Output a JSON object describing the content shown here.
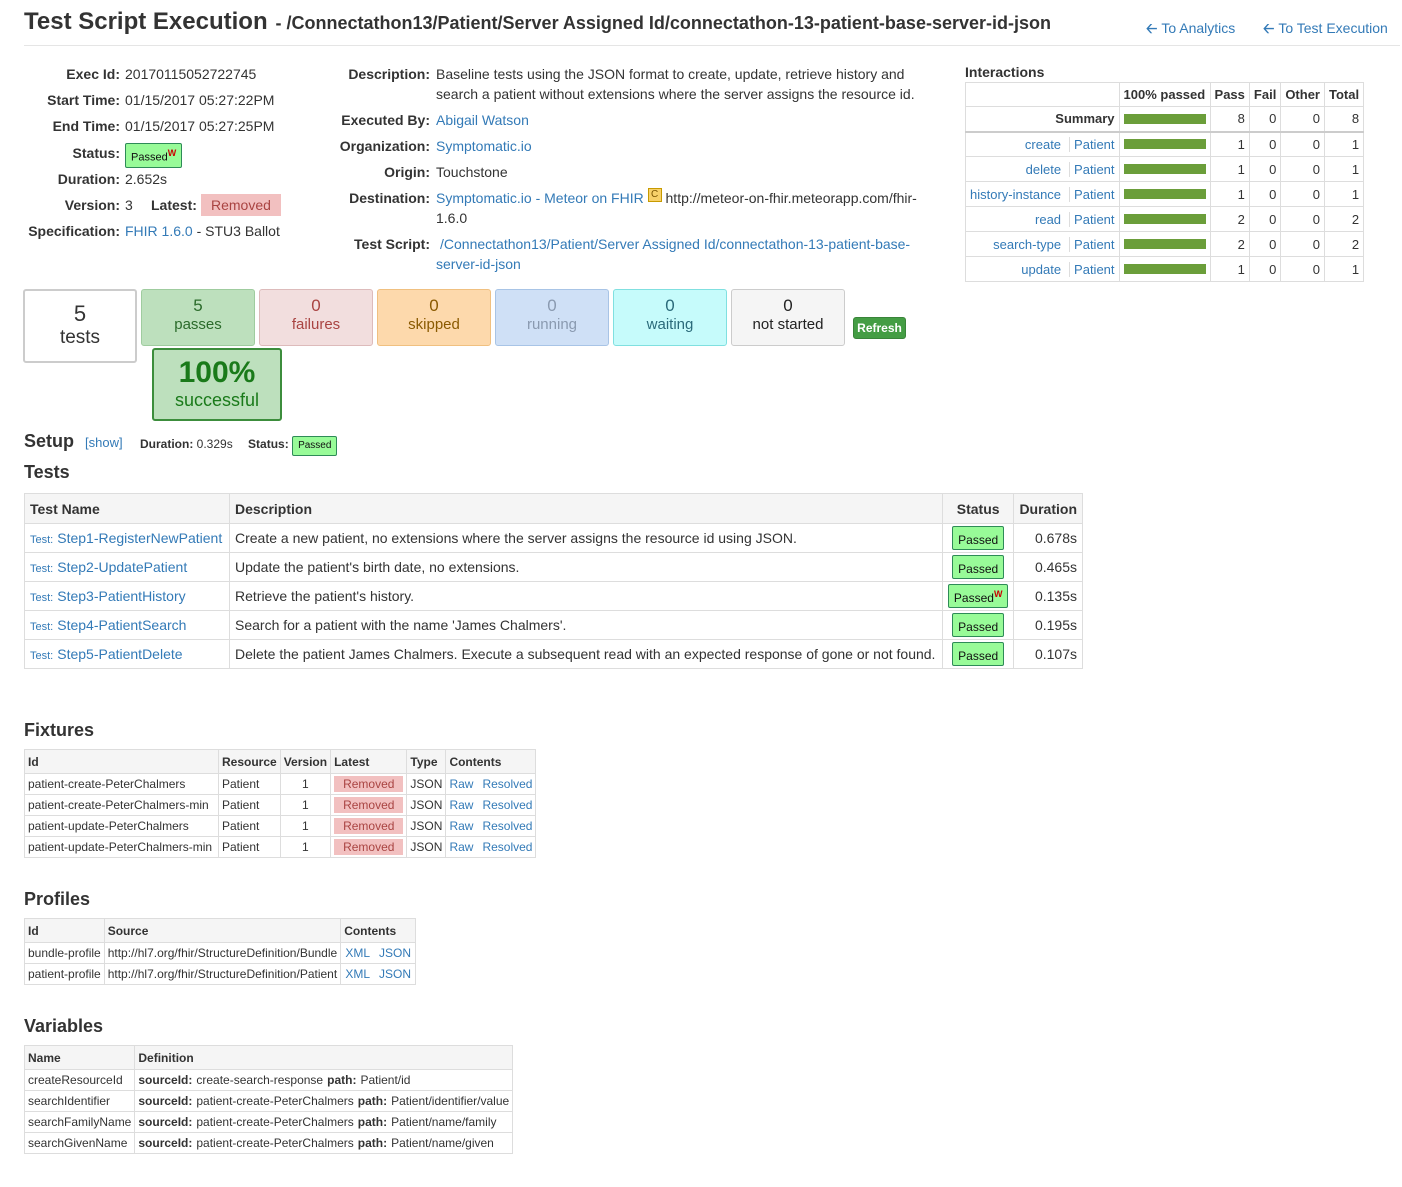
{
  "header": {
    "title": "Test Script Execution",
    "subtitle": "- /Connectathon13/Patient/Server Assigned Id/connectathon-13-patient-base-server-id-json",
    "nav_analytics": "To Analytics",
    "nav_execution": "To Test Execution"
  },
  "info": {
    "exec_id_label": "Exec Id:",
    "exec_id": "20170115052722745",
    "start_label": "Start Time:",
    "start": "01/15/2017 05:27:22PM",
    "end_label": "End Time:",
    "end": "01/15/2017 05:27:25PM",
    "status_label": "Status:",
    "status": "Passed",
    "status_sup": "W",
    "duration_label": "Duration:",
    "duration": "2.652s",
    "version_label": "Version:",
    "version": "3",
    "latest_label": "Latest:",
    "latest": "Removed",
    "spec_label": "Specification:",
    "spec_link": "FHIR 1.6.0",
    "spec_rest": "- STU3 Ballot"
  },
  "details": {
    "desc_label": "Description:",
    "desc_line1": "Baseline tests using the JSON format to create, update, retrieve history and",
    "desc_line2": "search a patient without extensions where the server assigns the resource id.",
    "exec_by_label": "Executed By:",
    "exec_by": "Abigail Watson",
    "org_label": "Organization:",
    "org": "Symptomatic.io",
    "origin_label": "Origin:",
    "origin": "Touchstone",
    "dest_label": "Destination:",
    "dest_link": "Symptomatic.io - Meteor on FHIR",
    "dest_icon": "C",
    "dest_url1": "http://meteor-on-fhir.meteorapp.com/fhir-",
    "dest_url2": "1.6.0",
    "script_label": "Test Script:",
    "script_line1": "/Connectathon13/Patient/Server Assigned Id/connectathon-13-patient-base-",
    "script_line2": "server-id-json"
  },
  "interactions": {
    "title": "Interactions",
    "headers": [
      "100% passed",
      "Pass",
      "Fail",
      "Other",
      "Total"
    ],
    "summary": {
      "label": "Summary",
      "pass": "8",
      "fail": "0",
      "other": "0",
      "total": "8",
      "pct": 1.0
    },
    "rows": [
      {
        "op": "create",
        "res": "Patient",
        "pass": "1",
        "fail": "0",
        "other": "0",
        "total": "1",
        "pct": 1.0
      },
      {
        "op": "delete",
        "res": "Patient",
        "pass": "1",
        "fail": "0",
        "other": "0",
        "total": "1",
        "pct": 1.0
      },
      {
        "op": "history-instance",
        "res": "Patient",
        "pass": "1",
        "fail": "0",
        "other": "0",
        "total": "1",
        "pct": 1.0
      },
      {
        "op": "read",
        "res": "Patient",
        "pass": "2",
        "fail": "0",
        "other": "0",
        "total": "2",
        "pct": 1.0
      },
      {
        "op": "search-type",
        "res": "Patient",
        "pass": "2",
        "fail": "0",
        "other": "0",
        "total": "2",
        "pct": 1.0
      },
      {
        "op": "update",
        "res": "Patient",
        "pass": "1",
        "fail": "0",
        "other": "0",
        "total": "1",
        "pct": 1.0
      }
    ]
  },
  "counts": {
    "tests_n": "5",
    "tests_label": "tests",
    "passes_n": "5",
    "passes_label": "passes",
    "failures_n": "0",
    "failures_label": "failures",
    "skipped_n": "0",
    "skipped_label": "skipped",
    "running_n": "0",
    "running_label": "running",
    "waiting_n": "0",
    "waiting_label": "waiting",
    "notstarted_n": "0",
    "notstarted_label": "not started",
    "refresh_label": "Refresh",
    "success_pct": "100%",
    "success_label": "successful"
  },
  "setup": {
    "title": "Setup",
    "show": "[show]",
    "duration_label": "Duration:",
    "duration": "0.329s",
    "status_label": "Status:",
    "status": "Passed"
  },
  "tests": {
    "title": "Tests",
    "headers": [
      "Test Name",
      "Description",
      "Status",
      "Duration"
    ],
    "prefix": "Test:",
    "rows": [
      {
        "name": "Step1-RegisterNewPatient",
        "desc": "Create a new patient, no extensions where the server assigns the resource id using JSON.",
        "status": "Passed",
        "sup": "",
        "dur": "0.678s"
      },
      {
        "name": "Step2-UpdatePatient",
        "desc": "Update the patient's birth date, no extensions.",
        "status": "Passed",
        "sup": "",
        "dur": "0.465s"
      },
      {
        "name": "Step3-PatientHistory",
        "desc": "Retrieve the patient's history.",
        "status": "Passed",
        "sup": "W",
        "dur": "0.135s"
      },
      {
        "name": "Step4-PatientSearch",
        "desc": "Search for a patient with the name 'James Chalmers'.",
        "status": "Passed",
        "sup": "",
        "dur": "0.195s"
      },
      {
        "name": "Step5-PatientDelete",
        "desc": "Delete the patient James Chalmers. Execute a subsequent read with an expected response of gone or not found.",
        "status": "Passed",
        "sup": "",
        "dur": "0.107s"
      }
    ]
  },
  "fixtures": {
    "title": "Fixtures",
    "headers": [
      "Id",
      "Resource",
      "Version",
      "Latest",
      "Type",
      "Contents"
    ],
    "rows": [
      {
        "id": "patient-create-PeterChalmers",
        "res": "Patient",
        "ver": "1",
        "latest": "Removed",
        "type": "JSON",
        "raw": "Raw",
        "resolved": "Resolved"
      },
      {
        "id": "patient-create-PeterChalmers-min",
        "res": "Patient",
        "ver": "1",
        "latest": "Removed",
        "type": "JSON",
        "raw": "Raw",
        "resolved": "Resolved"
      },
      {
        "id": "patient-update-PeterChalmers",
        "res": "Patient",
        "ver": "1",
        "latest": "Removed",
        "type": "JSON",
        "raw": "Raw",
        "resolved": "Resolved"
      },
      {
        "id": "patient-update-PeterChalmers-min",
        "res": "Patient",
        "ver": "1",
        "latest": "Removed",
        "type": "JSON",
        "raw": "Raw",
        "resolved": "Resolved"
      }
    ]
  },
  "profiles": {
    "title": "Profiles",
    "headers": [
      "Id",
      "Source",
      "Contents"
    ],
    "rows": [
      {
        "id": "bundle-profile",
        "src": "http://hl7.org/fhir/StructureDefinition/Bundle",
        "xml": "XML",
        "json": "JSON"
      },
      {
        "id": "patient-profile",
        "src": "http://hl7.org/fhir/StructureDefinition/Patient",
        "xml": "XML",
        "json": "JSON"
      }
    ]
  },
  "variables": {
    "title": "Variables",
    "headers": [
      "Name",
      "Definition"
    ],
    "src_label": "sourceId:",
    "path_label": "path:",
    "rows": [
      {
        "name": "createResourceId",
        "src": "create-search-response",
        "path": "Patient/id"
      },
      {
        "name": "searchIdentifier",
        "src": "patient-create-PeterChalmers",
        "path": "Patient/identifier/value"
      },
      {
        "name": "searchFamilyName",
        "src": "patient-create-PeterChalmers",
        "path": "Patient/name/family"
      },
      {
        "name": "searchGivenName",
        "src": "patient-create-PeterChalmers",
        "path": "Patient/name/given"
      }
    ]
  },
  "colors": {
    "link": "#337ab7",
    "passed_bg": "#98fb98",
    "removed_bg": "#f2c0c0",
    "bar": "#6b9e3a"
  }
}
